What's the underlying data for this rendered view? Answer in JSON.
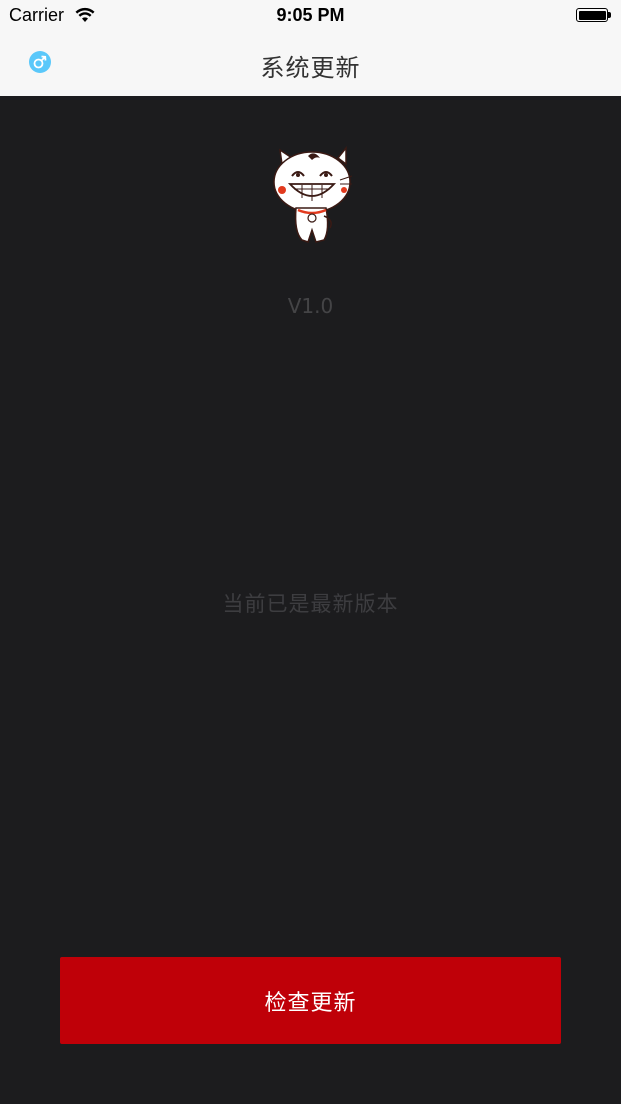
{
  "status_bar": {
    "carrier": "Carrier",
    "time": "9:05 PM",
    "wifi_icon": "wifi-icon",
    "battery_icon": "battery-icon"
  },
  "nav": {
    "back_icon": "male-symbol-icon",
    "back_icon_color": "#5ac8fa",
    "title": "系统更新"
  },
  "main": {
    "mascot_image": "cartoon-cat-mascot",
    "version": "V1.0",
    "status_message": "当前已是最新版本"
  },
  "actions": {
    "check_update_label": "检查更新",
    "check_update_color": "#bf0008"
  }
}
